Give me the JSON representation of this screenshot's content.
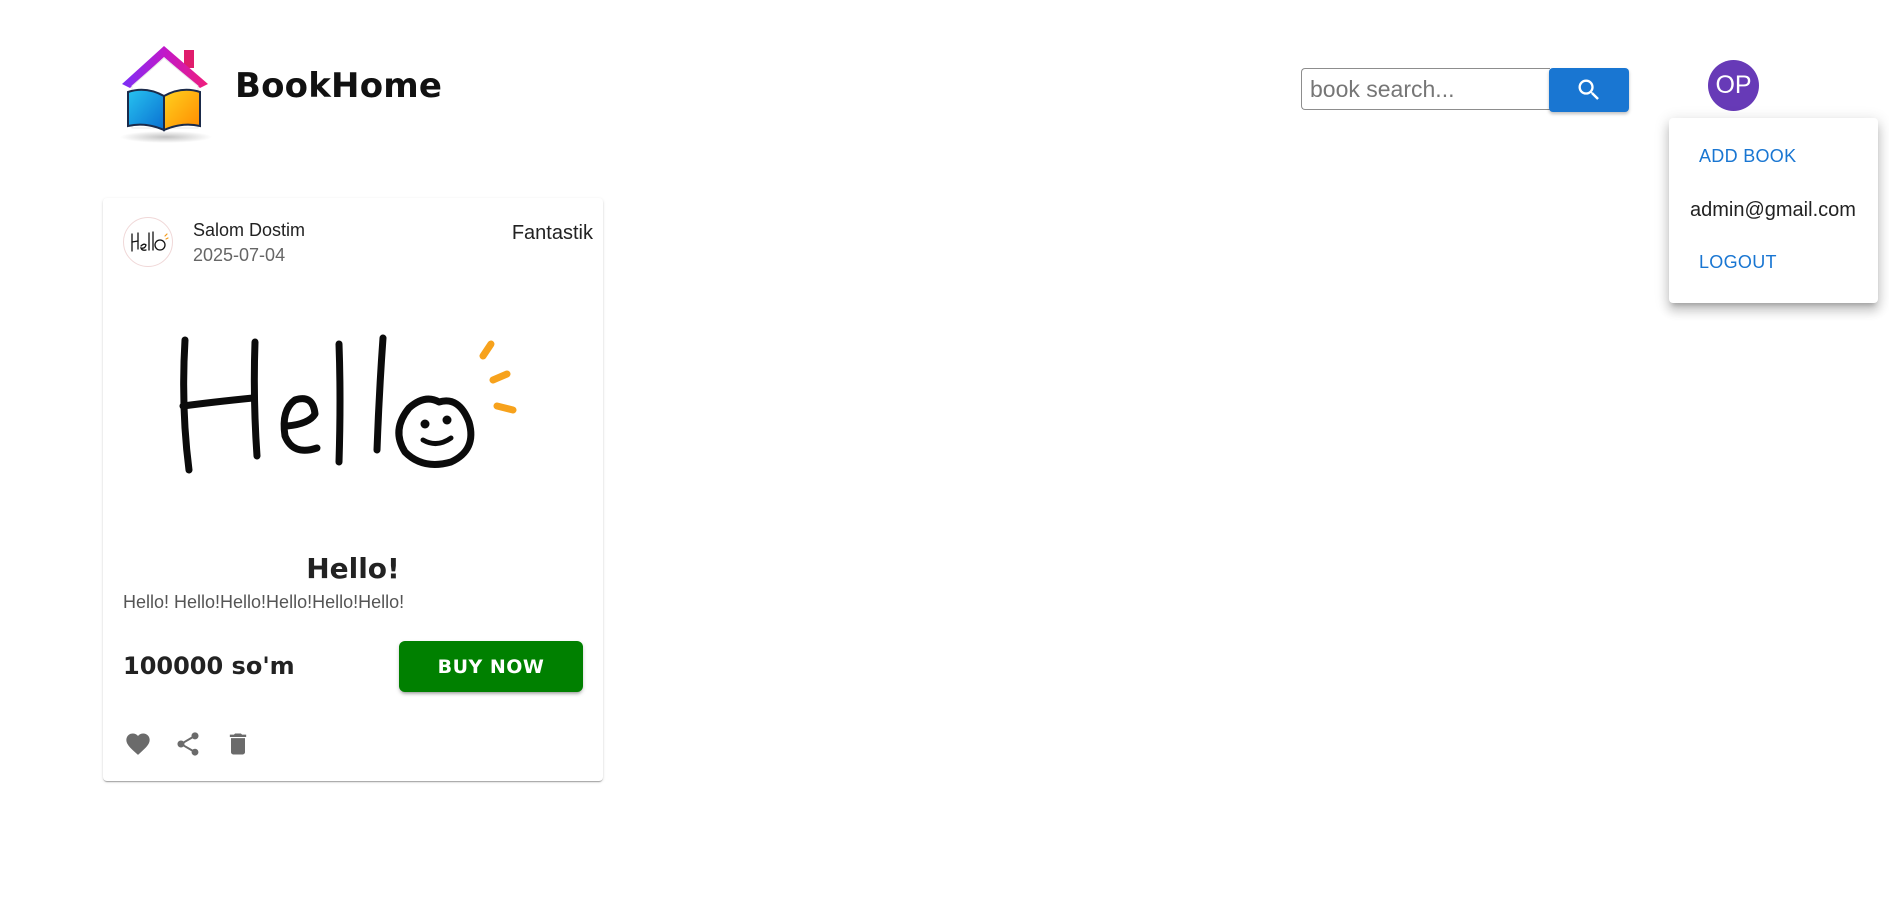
{
  "header": {
    "brand": "BookHome",
    "logo_icon": "house-book-logo-icon"
  },
  "search": {
    "placeholder": "book search...",
    "value": "",
    "button_icon": "search-icon",
    "accent": "#1976d2"
  },
  "user": {
    "initials": "OP",
    "avatar_color": "#673ab7"
  },
  "menu": {
    "add_book": "ADD BOOK",
    "email": "admin@gmail.com",
    "logout": "LOGOUT"
  },
  "card": {
    "author": "Salom Dostim",
    "date": "2025-07-04",
    "genre": "Fantastik",
    "title": "Hello!",
    "description": "Hello! Hello!Hello!Hello!Hello!Hello!",
    "image_text": "Hello",
    "price": "100000 so'm",
    "buy_label": "BUY NOW",
    "buy_color": "#008000",
    "actions": [
      "favorite-icon",
      "share-icon",
      "delete-icon"
    ]
  }
}
